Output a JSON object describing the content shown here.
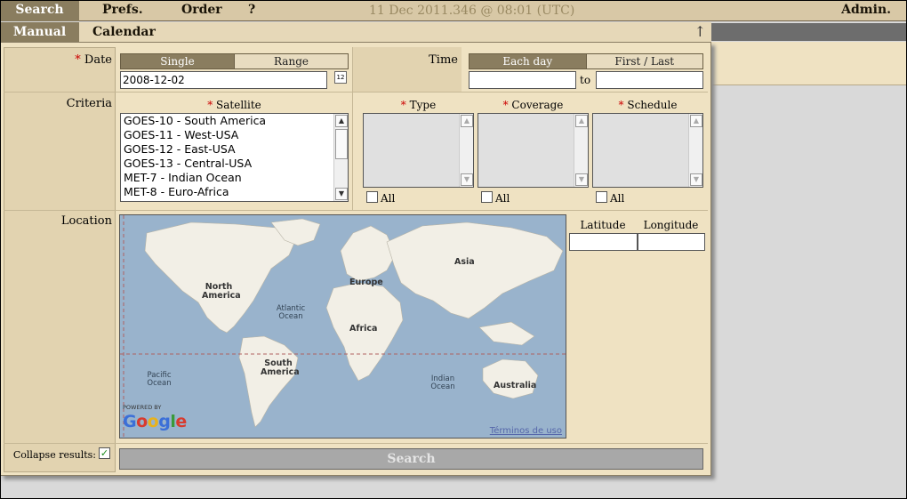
{
  "nav": {
    "search": "Search",
    "prefs": "Prefs.",
    "order": "Order",
    "help": "?",
    "admin": "Admin.",
    "clock": "11 Dec 2011.346 @ 08:01 (UTC)"
  },
  "subnav": {
    "manual": "Manual",
    "calendar": "Calendar",
    "collapse_glyph": "↑"
  },
  "date": {
    "label": "Date",
    "single": "Single",
    "range": "Range",
    "value": "2008-12-02",
    "calendar_icon": "calendar-icon"
  },
  "time": {
    "label": "Time",
    "each_day": "Each day",
    "first_last": "First / Last",
    "to": "to",
    "from_value": "",
    "to_value": ""
  },
  "criteria": {
    "label": "Criteria",
    "satellite_label": "Satellite",
    "satellites": [
      "GOES-10 - South America",
      "GOES-11 - West-USA",
      "GOES-12 - East-USA",
      "GOES-13 - Central-USA",
      "MET-7 - Indian Ocean",
      "MET-8 - Euro-Africa"
    ],
    "type_label": "Type",
    "coverage_label": "Coverage",
    "schedule_label": "Schedule",
    "all_label": "All",
    "required_mark": "*"
  },
  "location": {
    "label": "Location",
    "latitude": "Latitude",
    "longitude": "Longitude",
    "latitude_value": "",
    "longitude_value": "",
    "map": {
      "continents": {
        "north_america": "North\nAmerica",
        "south_america": "South\nAmerica",
        "europe": "Europe",
        "africa": "Africa",
        "asia": "Asia",
        "australia": "Australia"
      },
      "oceans": {
        "atlantic": "Atlantic\nOcean",
        "pacific": "Pacific\nOcean",
        "indian": "Indian\nOcean"
      },
      "powered_by": "POWERED BY",
      "google": "Google",
      "terms": "Términos de uso"
    }
  },
  "footer": {
    "collapse_results": "Collapse results:",
    "collapse_checked": true,
    "search_button": "Search"
  },
  "colors": {
    "nav_bg": "#d8c8a6",
    "active_tab": "#8a7d5f",
    "panel_bg": "#efe2c2",
    "required": "#cc0000",
    "ocean": "#99b3cc",
    "land": "#f2efe6"
  }
}
